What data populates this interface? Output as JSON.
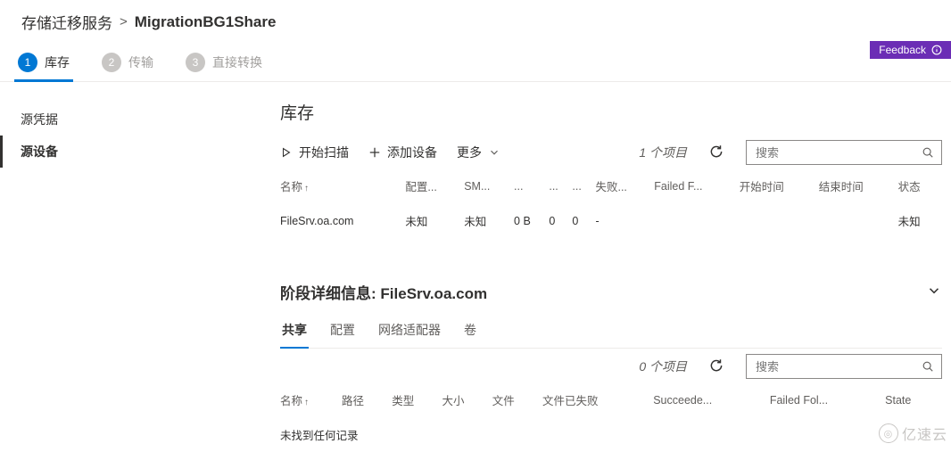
{
  "breadcrumb": {
    "parent": "存储迁移服务",
    "current": "MigrationBG1Share"
  },
  "feedback_label": "Feedback",
  "steps": [
    {
      "num": "1",
      "label": "库存",
      "active": true
    },
    {
      "num": "2",
      "label": "传输",
      "active": false
    },
    {
      "num": "3",
      "label": "直接转换",
      "active": false
    }
  ],
  "sidebar": {
    "items": [
      {
        "label": "源凭据",
        "active": false
      },
      {
        "label": "源设备",
        "active": true
      }
    ]
  },
  "inventory": {
    "title": "库存",
    "start_scan": "开始扫描",
    "add_device": "添加设备",
    "more": "更多",
    "item_count": "1 个项目",
    "search_placeholder": "搜索",
    "columns": {
      "name": "名称",
      "config": "配置...",
      "sm": "SM...",
      "c3": "...",
      "c4": "...",
      "failed": "失败...",
      "failedf": "Failed F...",
      "start": "开始时间",
      "end": "结束时间",
      "state": "状态"
    },
    "rows": [
      {
        "name": "FileSrv.oa.com",
        "config": "未知",
        "sm": "未知",
        "c3": "0 B",
        "c4": "0",
        "c5": "0",
        "failed": "-",
        "failedf": "",
        "start": "",
        "end": "",
        "state": "未知"
      }
    ]
  },
  "details": {
    "title_prefix": "阶段详细信息:",
    "title_target": "FileSrv.oa.com",
    "tabs": [
      {
        "label": "共享",
        "active": true
      },
      {
        "label": "配置",
        "active": false
      },
      {
        "label": "网络适配器",
        "active": false
      },
      {
        "label": "卷",
        "active": false
      }
    ],
    "item_count": "0 个项目",
    "search_placeholder": "搜索",
    "columns": {
      "name": "名称",
      "path": "路径",
      "type": "类型",
      "size": "大小",
      "files": "文件",
      "files_failed": "文件已失败",
      "succeeded": "Succeede...",
      "failed_fol": "Failed Fol...",
      "state": "State"
    },
    "empty_text": "未找到任何记录"
  },
  "watermark": "亿速云"
}
